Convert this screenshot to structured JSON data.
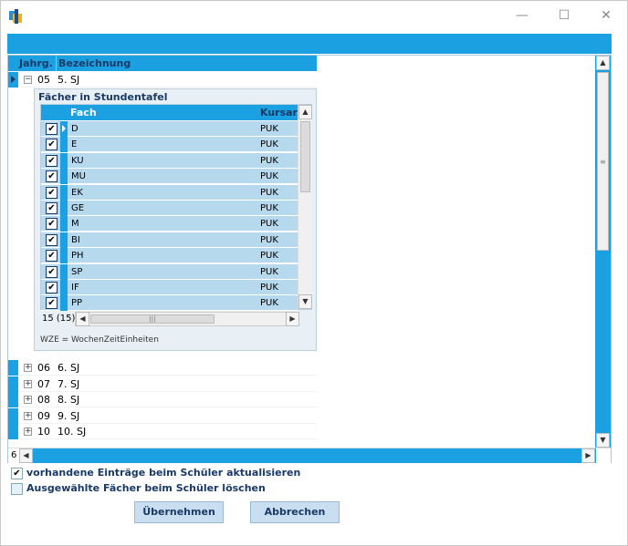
{
  "window": {
    "icon": "app-icon",
    "controls": [
      "—",
      "☐",
      "✕"
    ]
  },
  "grid": {
    "headers": {
      "jahrg": "Jahrg.",
      "bezeichnung": "Bezeichnung"
    },
    "expanded_row": {
      "jahr": "05",
      "bez": "5. SJ",
      "toggle": "−"
    },
    "detail": {
      "title": "Fächer in Stundentafel",
      "headers": {
        "fach": "Fach",
        "kursart": "Kursart"
      },
      "rows": [
        {
          "fach": "D",
          "kurs": "PUK",
          "checked": "✔"
        },
        {
          "fach": "E",
          "kurs": "PUK",
          "checked": "✔"
        },
        {
          "fach": "KU",
          "kurs": "PUK",
          "checked": "✔"
        },
        {
          "fach": "MU",
          "kurs": "PUK",
          "checked": "✔"
        },
        {
          "fach": "EK",
          "kurs": "PUK",
          "checked": "✔"
        },
        {
          "fach": "GE",
          "kurs": "PUK",
          "checked": "✔"
        },
        {
          "fach": "M",
          "kurs": "PUK",
          "checked": "✔"
        },
        {
          "fach": "BI",
          "kurs": "PUK",
          "checked": "✔"
        },
        {
          "fach": "PH",
          "kurs": "PUK",
          "checked": "✔"
        },
        {
          "fach": "SP",
          "kurs": "PUK",
          "checked": "✔"
        },
        {
          "fach": "IF",
          "kurs": "PUK",
          "checked": "✔"
        },
        {
          "fach": "PP",
          "kurs": "PUK",
          "checked": "✔"
        }
      ],
      "count": "15 (15)",
      "legend": "WZE = WochenZeitEinheiten"
    },
    "other_rows": [
      {
        "jahr": "06",
        "bez": "6. SJ",
        "toggle": "+"
      },
      {
        "jahr": "07",
        "bez": "7. SJ",
        "toggle": "+"
      },
      {
        "jahr": "08",
        "bez": "8. SJ",
        "toggle": "+"
      },
      {
        "jahr": "09",
        "bez": "9. SJ",
        "toggle": "+"
      },
      {
        "jahr": "10",
        "bez": "10. SJ",
        "toggle": "+"
      }
    ],
    "count": "6"
  },
  "options": {
    "update": {
      "label": "vorhandene Einträge beim Schüler aktualisieren",
      "mark": "✔"
    },
    "delete": {
      "label": "Ausgewählte Fächer beim Schüler löschen",
      "mark": ""
    }
  },
  "buttons": {
    "ok": "Übernehmen",
    "cancel": "Abbrechen"
  },
  "colors": {
    "accent": "#1ba1e2",
    "row_fill": "#b7d9ee",
    "label": "#1a3a66"
  }
}
